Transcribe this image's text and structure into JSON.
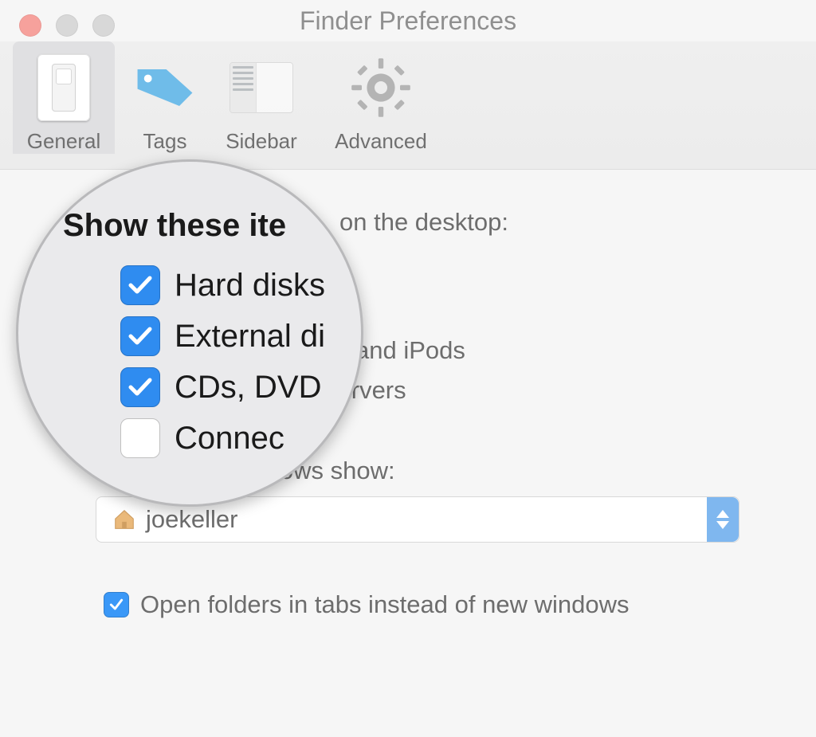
{
  "window": {
    "title": "Finder Preferences"
  },
  "toolbar": {
    "general": "General",
    "tags": "Tags",
    "sidebar": "Sidebar",
    "advanced": "Advanced",
    "active": "general"
  },
  "content": {
    "desktop_items_label": "on the desktop:",
    "options": [
      {
        "label_fragment": "",
        "checked": true
      },
      {
        "label_fragment": "",
        "checked": true
      },
      {
        "label_fragment": "and iPods",
        "checked": true
      },
      {
        "label_fragment": "servers",
        "checked": false
      }
    ],
    "new_windows_label": "New Finder windows show:",
    "new_windows_value": "joekeller",
    "open_in_tabs": {
      "checked": true,
      "label": "Open folders in tabs instead of new windows"
    }
  },
  "magnifier": {
    "title": "Show these ite",
    "items": [
      {
        "label": "Hard disks",
        "checked": true
      },
      {
        "label": "External di",
        "checked": true
      },
      {
        "label": "CDs, DVD",
        "checked": true
      },
      {
        "label": "Connec",
        "checked": false
      }
    ]
  },
  "colors": {
    "accent": "#3a98f7"
  }
}
